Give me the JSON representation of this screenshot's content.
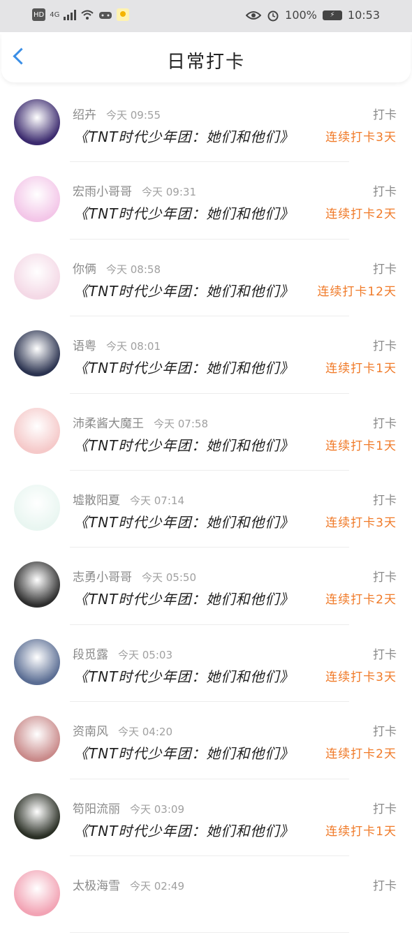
{
  "status_bar": {
    "network_hd": "HD",
    "network_gen": "4G",
    "battery_percent": "100%",
    "time": "10:53",
    "icons": [
      "hd-icon",
      "signal-icon",
      "wifi-icon",
      "game-icon",
      "weather-icon",
      "eye-icon",
      "alarm-icon",
      "battery-icon"
    ]
  },
  "header": {
    "title": "日常打卡"
  },
  "checkins": [
    {
      "user": "绍卉",
      "time": "今天 09:55",
      "type": "打卡",
      "book": "《TNT时代少年团：她们和他们》",
      "streak": "连续打卡3天",
      "avatar_color": "#3b2a6e"
    },
    {
      "user": "宏雨小哥哥",
      "time": "今天 09:31",
      "type": "打卡",
      "book": "《TNT时代少年团：她们和他们》",
      "streak": "连续打卡2天",
      "avatar_color": "#f3c6e8"
    },
    {
      "user": "你俩",
      "time": "今天 08:58",
      "type": "打卡",
      "book": "《TNT时代少年团：她们和他们》",
      "streak": "连续打卡12天",
      "avatar_color": "#f4d9e6"
    },
    {
      "user": "语粤",
      "time": "今天 08:01",
      "type": "打卡",
      "book": "《TNT时代少年团：她们和他们》",
      "streak": "连续打卡1天",
      "avatar_color": "#2b3350"
    },
    {
      "user": "沛柔酱大魔王",
      "time": "今天 07:58",
      "type": "打卡",
      "book": "《TNT时代少年团：她们和他们》",
      "streak": "连续打卡1天",
      "avatar_color": "#f5c9c9"
    },
    {
      "user": "墟散阳夏",
      "time": "今天 07:14",
      "type": "打卡",
      "book": "《TNT时代少年团：她们和他们》",
      "streak": "连续打卡3天",
      "avatar_color": "#e9f6f1"
    },
    {
      "user": "志勇小哥哥",
      "time": "今天 05:50",
      "type": "打卡",
      "book": "《TNT时代少年团：她们和他们》",
      "streak": "连续打卡2天",
      "avatar_color": "#2e2e2e"
    },
    {
      "user": "段觅露",
      "time": "今天 05:03",
      "type": "打卡",
      "book": "《TNT时代少年团：她们和他们》",
      "streak": "连续打卡3天",
      "avatar_color": "#5a6d93"
    },
    {
      "user": "资南风",
      "time": "今天 04:20",
      "type": "打卡",
      "book": "《TNT时代少年团：她们和他们》",
      "streak": "连续打卡2天",
      "avatar_color": "#c98a8a"
    },
    {
      "user": "笱阳流丽",
      "time": "今天 03:09",
      "type": "打卡",
      "book": "《TNT时代少年团：她们和他们》",
      "streak": "连续打卡1天",
      "avatar_color": "#2a2f25"
    },
    {
      "user": "太极海雪",
      "time": "今天 02:49",
      "type": "打卡",
      "book": "",
      "streak": "",
      "avatar_color": "#f2a3b4"
    }
  ],
  "colors": {
    "accent_orange": "#f07a28",
    "back_blue": "#3a8ee6"
  }
}
